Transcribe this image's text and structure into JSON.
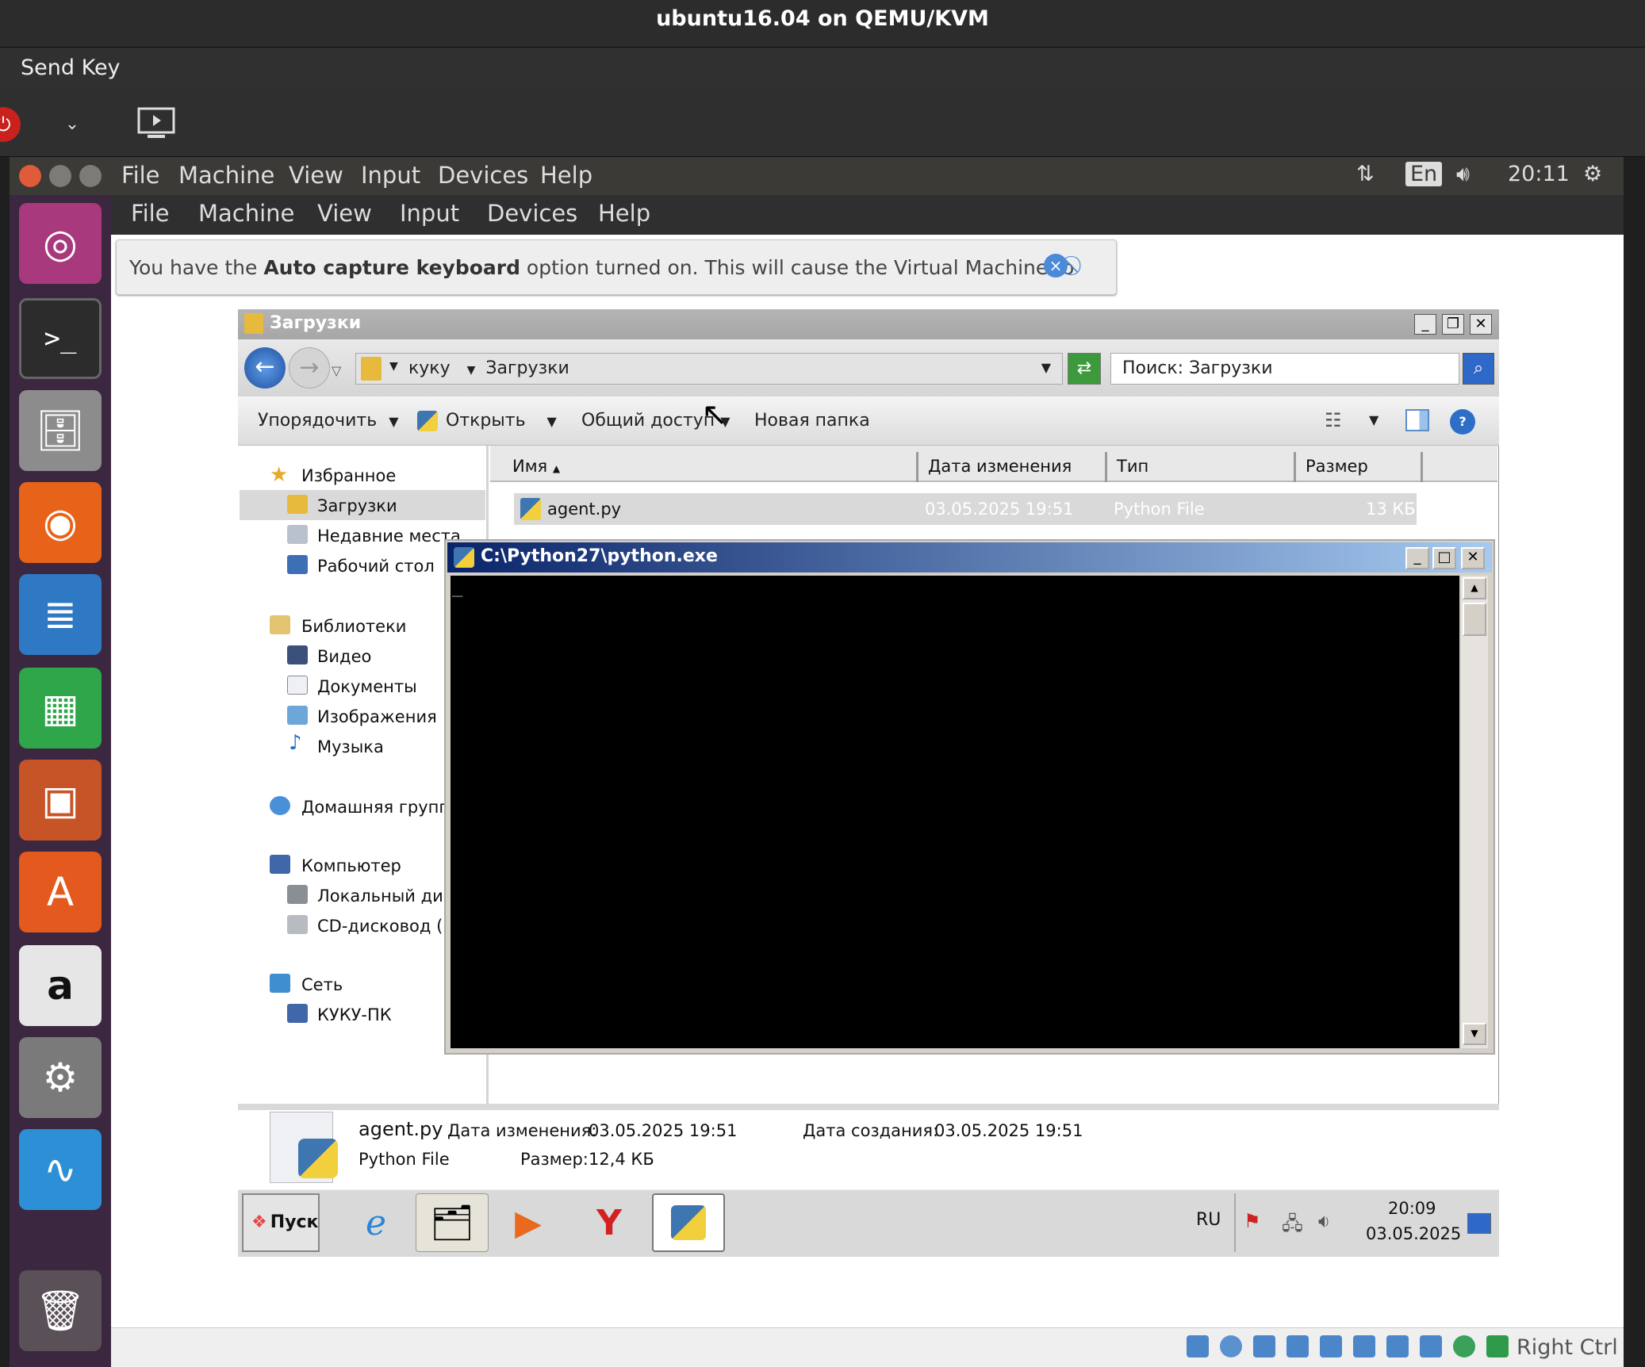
{
  "host": {
    "title": "ubuntu16.04 on QEMU/KVM",
    "send_key": "Send Key"
  },
  "unity": {
    "menu": [
      "File",
      "Machine",
      "View",
      "Input",
      "Devices",
      "Help"
    ],
    "lang": "En",
    "time": "20:11"
  },
  "vbox": {
    "menu": [
      "File",
      "Machine",
      "View",
      "Input",
      "Devices",
      "Help"
    ],
    "notice": {
      "pre": "You have the ",
      "bold": "Auto capture keyboard",
      "post": " option turned on. This will cause the Virtual Machine to"
    },
    "host_key": "Right Ctrl"
  },
  "explorer": {
    "title": "Загрузки",
    "crumb1": "куку",
    "crumb2": "Загрузки",
    "search": "Поиск: Загрузки",
    "cmds": [
      "Упорядочить",
      "Открыть",
      "Общий доступ",
      "Новая папка"
    ],
    "nav": {
      "fav": "Избранное",
      "downloads": "Загрузки",
      "recent": "Недавние места",
      "desktop": "Рабочий стол",
      "libs": "Библиотеки",
      "video": "Видео",
      "docs": "Документы",
      "images": "Изображения",
      "music": "Музыка",
      "homegroup": "Домашняя группа",
      "computer": "Компьютер",
      "local": "Локальный дис",
      "cd": "CD-дисковод (D",
      "network": "Сеть",
      "pc": "КУКУ-ПК"
    },
    "columns": [
      "Имя",
      "Дата изменения",
      "Тип",
      "Размер"
    ],
    "file": {
      "name": "agent.py",
      "date": "03.05.2025 19:51",
      "type": "Python File",
      "size": "13 КБ"
    },
    "details": {
      "name": "agent.py",
      "mod_label": "Дата изменения:",
      "mod": "03.05.2025 19:51",
      "created_label": "Дата создания:",
      "created": "03.05.2025 19:51",
      "type": "Python File",
      "size_label": "Размер:",
      "size": "12,4 КБ"
    }
  },
  "console": {
    "title": "C:\\Python27\\python.exe",
    "cursor": "_"
  },
  "taskbar": {
    "start": "Пуск",
    "lang": "RU",
    "time": "20:09",
    "date": "03.05.2025"
  },
  "colors": {
    "ubuntu_orange": "#dd4814",
    "launcher_bg": "#3b2840",
    "xp_title": "#0a246a"
  }
}
